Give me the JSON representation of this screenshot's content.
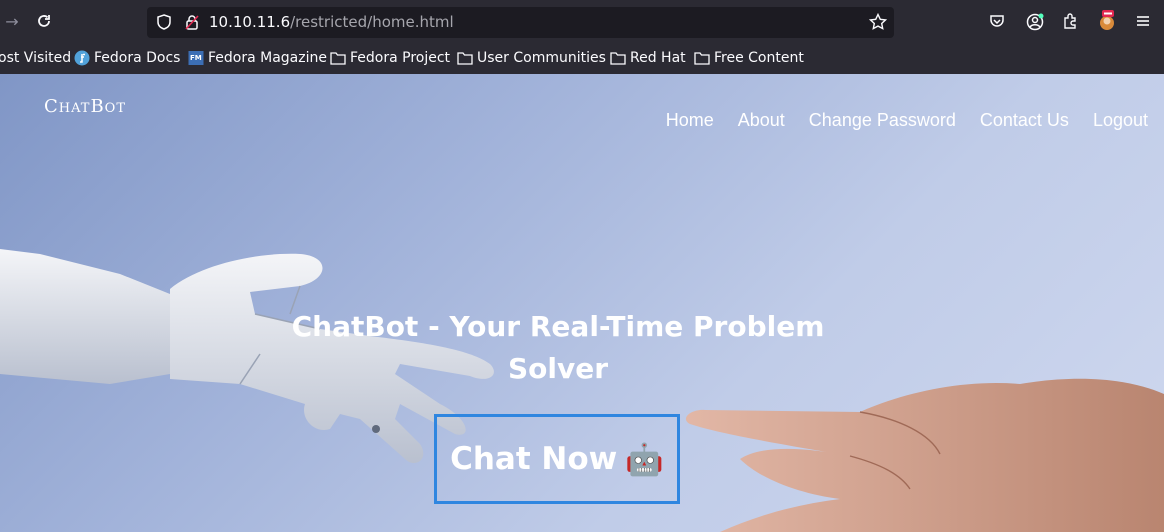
{
  "browser": {
    "url_host": "10.10.11.6",
    "url_path": "/restricted/home.html",
    "bookmarks": [
      {
        "label": "ost Visited",
        "icon": "settings-icon"
      },
      {
        "label": "Fedora Docs",
        "icon": "fedora-icon"
      },
      {
        "label": "Fedora Magazine",
        "icon": "fm-icon"
      },
      {
        "label": "Fedora Project",
        "icon": "folder-icon"
      },
      {
        "label": "User Communities",
        "icon": "folder-icon"
      },
      {
        "label": "Red Hat",
        "icon": "folder-icon"
      },
      {
        "label": "Free Content",
        "icon": "folder-icon"
      }
    ]
  },
  "site": {
    "brand": "ChatBot",
    "nav": [
      "Home",
      "About",
      "Change Password",
      "Contact Us",
      "Logout"
    ],
    "hero_title": "ChatBot - Your Real-Time Problem Solver",
    "cta_label": "Chat Now",
    "cta_emoji": "🤖"
  },
  "colors": {
    "chrome_bg": "#2b2a33",
    "urlbar_bg": "#1c1b22",
    "cta_border": "#2f86e0"
  }
}
